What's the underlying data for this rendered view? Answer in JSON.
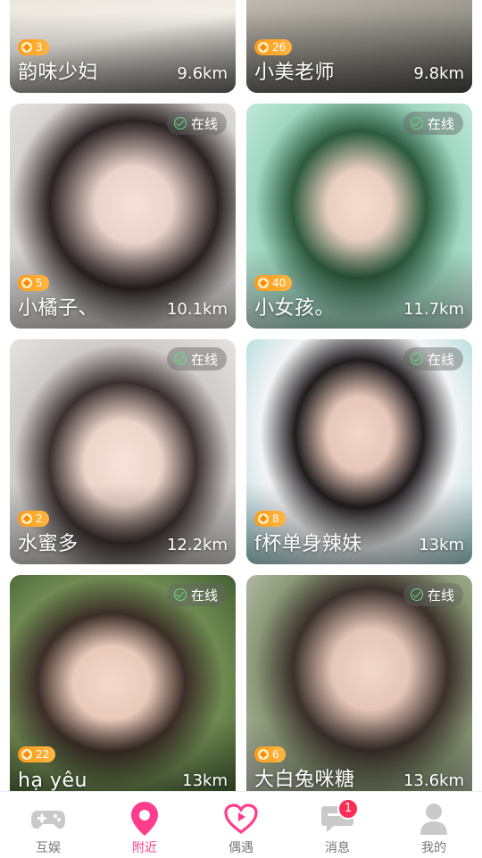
{
  "cards": [
    {
      "name": "韵味少妇",
      "distance": "9.6km",
      "level": "3",
      "online": false
    },
    {
      "name": "小美老师",
      "distance": "9.8km",
      "level": "26",
      "online": false
    },
    {
      "name": "小橘子、",
      "distance": "10.1km",
      "level": "5",
      "online": true
    },
    {
      "name": "小女孩。",
      "distance": "11.7km",
      "level": "40",
      "online": true
    },
    {
      "name": "水蜜多",
      "distance": "12.2km",
      "level": "2",
      "online": true
    },
    {
      "name": "f杯单身辣妹",
      "distance": "13km",
      "level": "8",
      "online": true
    },
    {
      "name": "hạ yêu",
      "distance": "13km",
      "level": "22",
      "online": true
    },
    {
      "name": "大白兔咪糖",
      "distance": "13.6km",
      "level": "6",
      "online": true
    }
  ],
  "online_label": "在线",
  "tabbar": {
    "items": [
      {
        "label": "互娱",
        "icon": "gamepad-icon"
      },
      {
        "label": "附近",
        "icon": "location-pin-icon"
      },
      {
        "label": "偶遇",
        "icon": "heart-play-icon"
      },
      {
        "label": "消息",
        "icon": "chat-bubble-icon",
        "badge": "1"
      },
      {
        "label": "我的",
        "icon": "person-icon"
      }
    ],
    "active_index": 1
  },
  "colors": {
    "accent": "#ff3d8c",
    "level_badge": "#ff9b1a",
    "online_check": "#5fe07a",
    "notification": "#ff2d55"
  }
}
